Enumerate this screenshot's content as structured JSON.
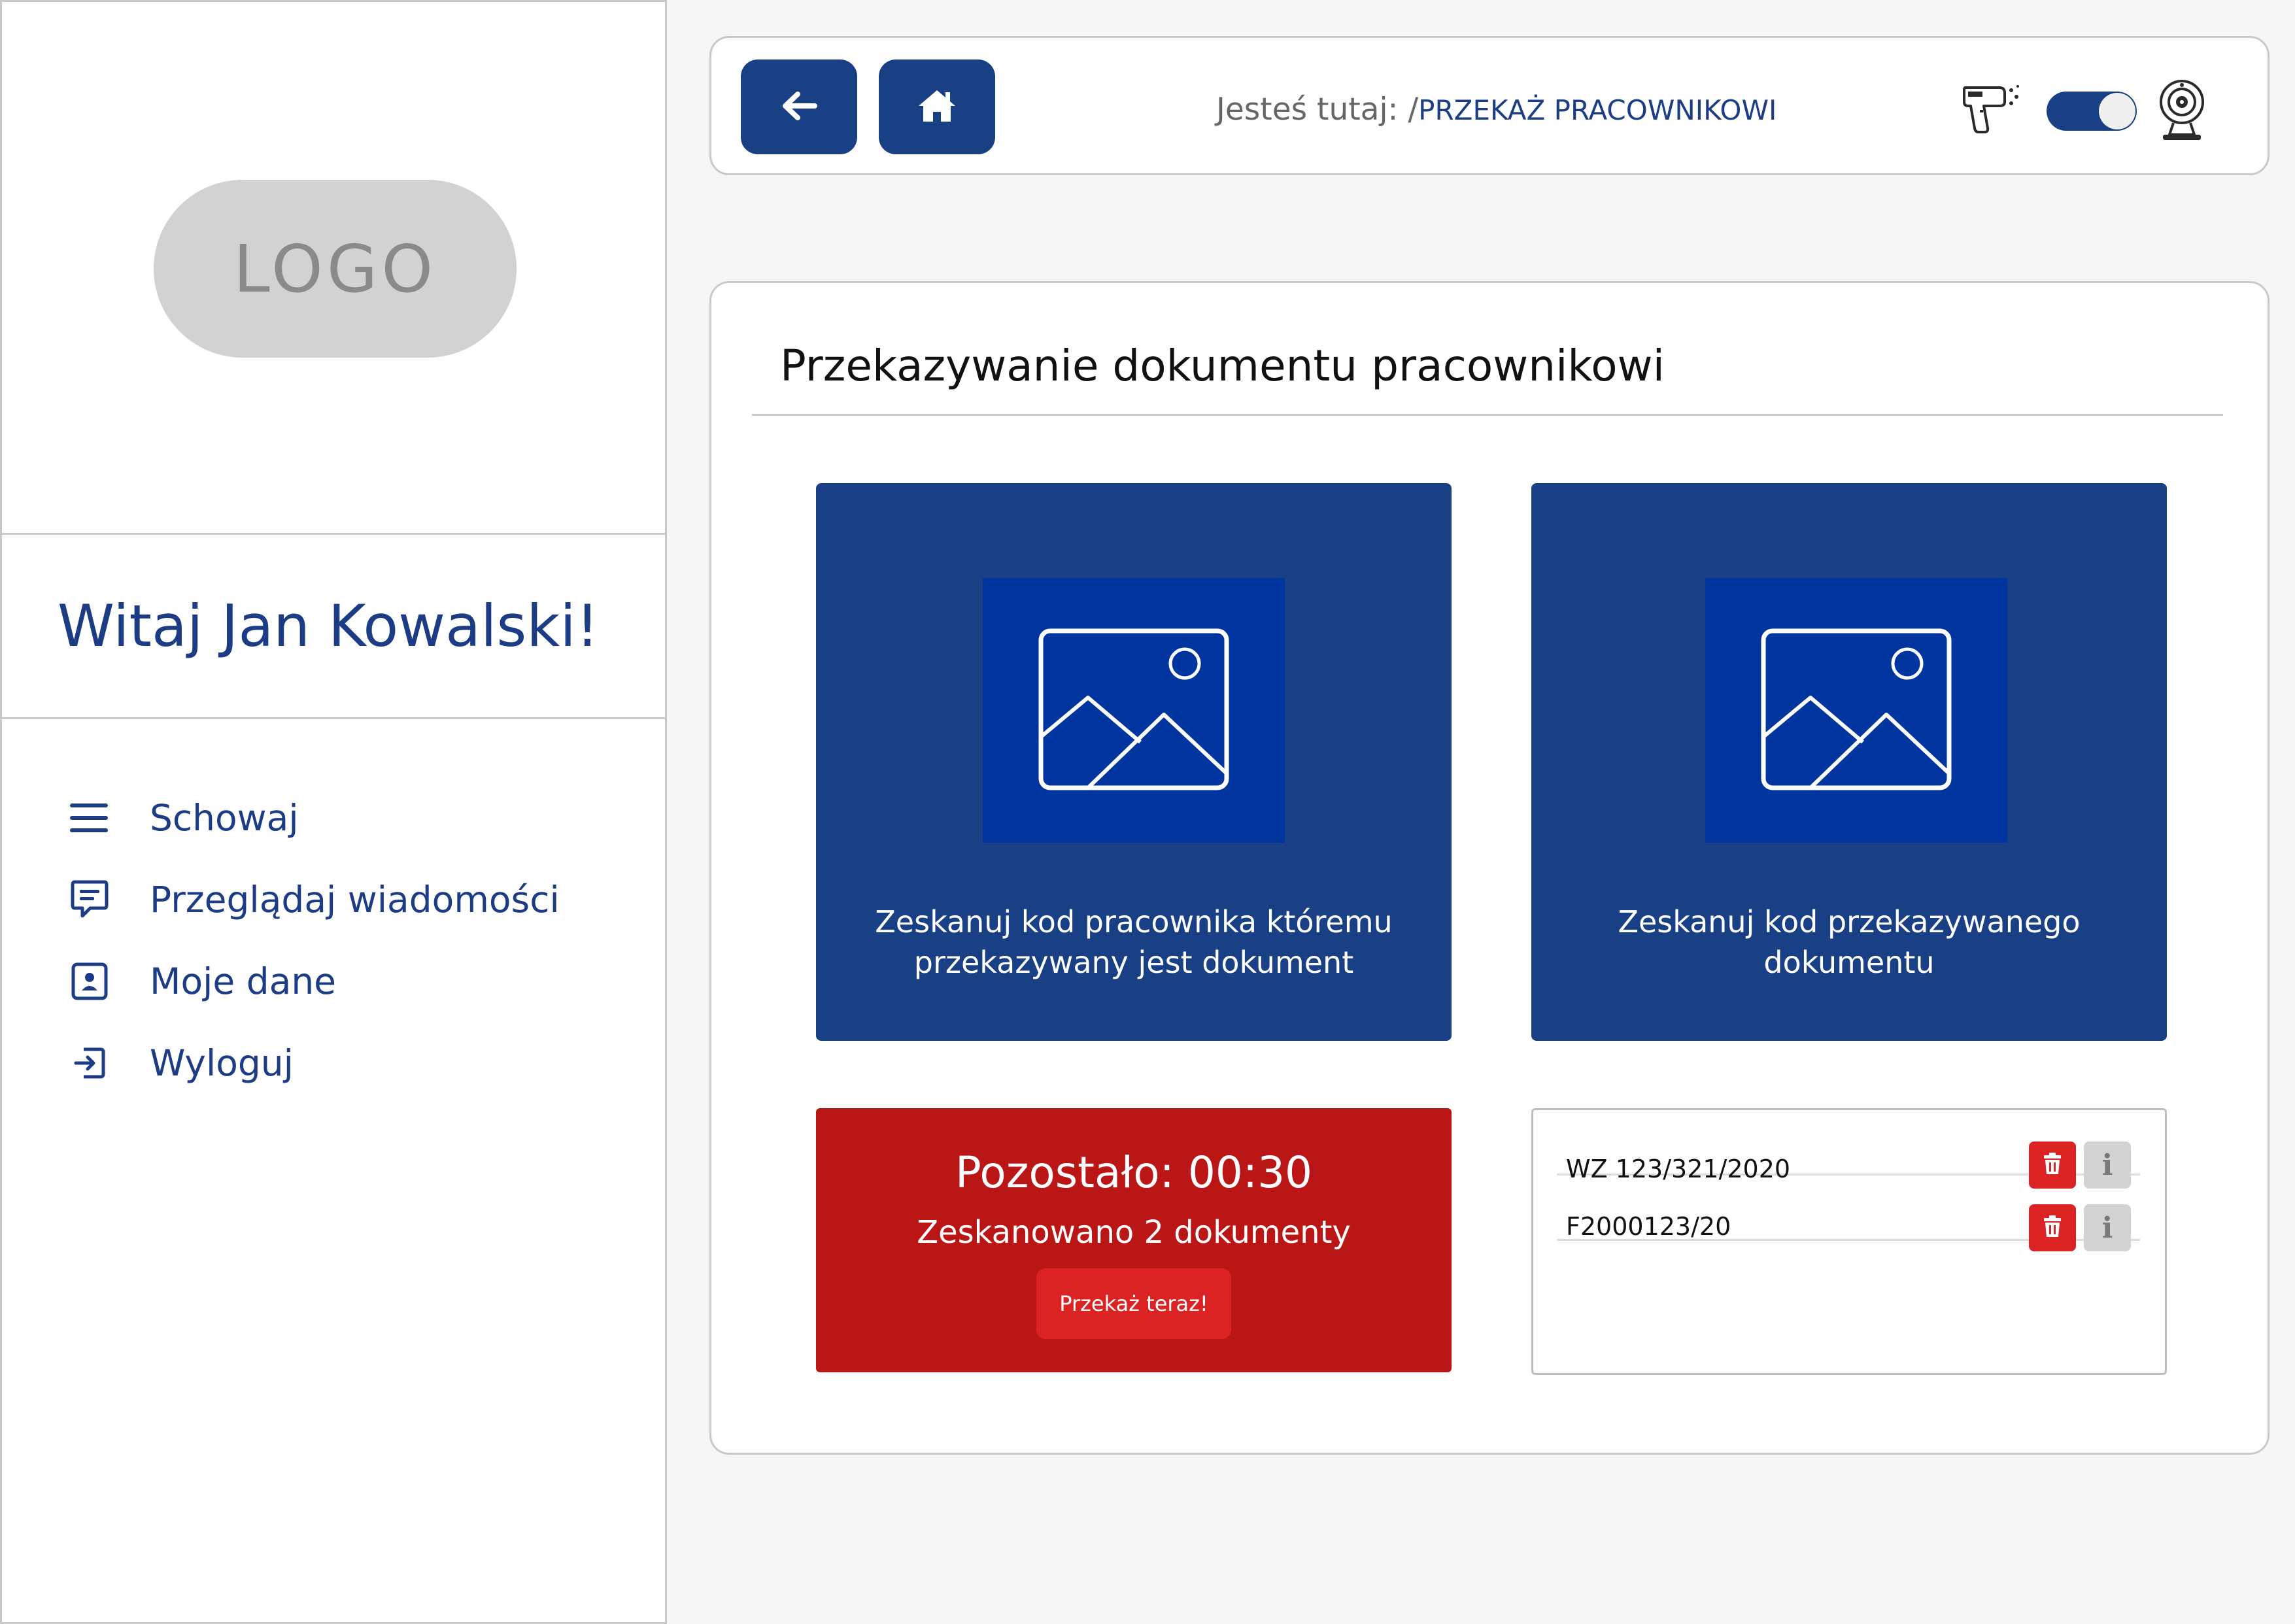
{
  "sidebar": {
    "logo": "LOGO",
    "greeting": "Witaj Jan Kowalski!",
    "items": [
      {
        "label": "Schowaj",
        "icon": "menu-icon"
      },
      {
        "label": "Przeglądaj wiadomości",
        "icon": "message-icon"
      },
      {
        "label": "Moje dane",
        "icon": "profile-icon"
      },
      {
        "label": "Wyloguj",
        "icon": "logout-icon"
      }
    ]
  },
  "topbar": {
    "back_icon": "arrow-left-icon",
    "home_icon": "home-icon",
    "breadcrumb_prefix": "Jesteś tutaj: /",
    "breadcrumb_current": "PRZEKAŻ PRACOWNIKOWI",
    "scanner_icon": "barcode-scanner-icon",
    "toggle_state": "on",
    "webcam_icon": "webcam-icon"
  },
  "main": {
    "title": "Przekazywanie dokumentu pracownikowi",
    "cards": [
      {
        "text": "Zeskanuj kod pracownika któremu przekazywany jest dokument",
        "icon": "image-placeholder-icon"
      },
      {
        "text": "Zeskanuj kod przekazywanego dokumentu",
        "icon": "image-placeholder-icon"
      }
    ],
    "timer": {
      "remaining": "Pozostało: 00:30",
      "scanned": "Zeskanowano 2 dokumenty",
      "button": "Przekaż teraz!"
    },
    "documents": [
      {
        "code": "WZ 123/321/2020"
      },
      {
        "code": "F2000123/20"
      }
    ],
    "info_label": "i"
  },
  "colors": {
    "primary": "#193f85",
    "image_bg": "#0035a0",
    "danger": "#bb1616",
    "danger_button": "#dc2323",
    "text_blue": "#1c3c85"
  }
}
